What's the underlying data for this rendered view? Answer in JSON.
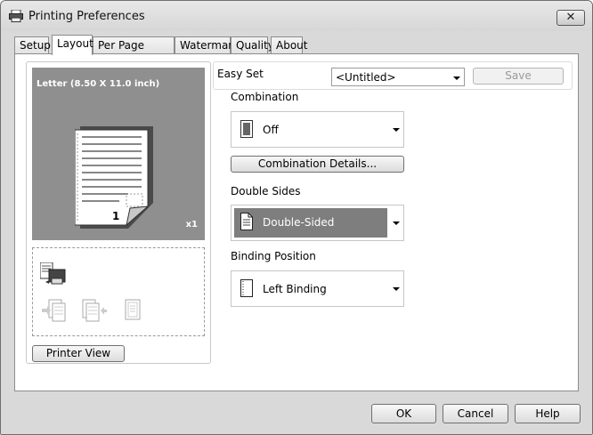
{
  "window": {
    "title": "Printing Preferences",
    "close_label": "✕"
  },
  "tabs": [
    {
      "label": "Setup"
    },
    {
      "label": "Layout"
    },
    {
      "label": "Per Page Setting"
    },
    {
      "label": "Watermark"
    },
    {
      "label": "Quality"
    },
    {
      "label": "About"
    }
  ],
  "active_tab": "Layout",
  "preview": {
    "paper_label": "Letter  (8.50 X 11.0 inch)",
    "page_number": "1",
    "copies": "x1"
  },
  "printer_view_button": "Printer View",
  "easy_set": {
    "label": "Easy Set",
    "value": "<Untitled>",
    "save_label": "Save"
  },
  "combination": {
    "label": "Combination",
    "value": "Off",
    "details_button": "Combination Details..."
  },
  "double_sides": {
    "label": "Double Sides",
    "value": "Double-Sided"
  },
  "binding_position": {
    "label": "Binding Position",
    "value": "Left Binding"
  },
  "footer": {
    "ok": "OK",
    "cancel": "Cancel",
    "help": "Help"
  },
  "colors": {
    "preview_bg": "#8f8f8f",
    "selected_bg": "#7e7e7e"
  }
}
